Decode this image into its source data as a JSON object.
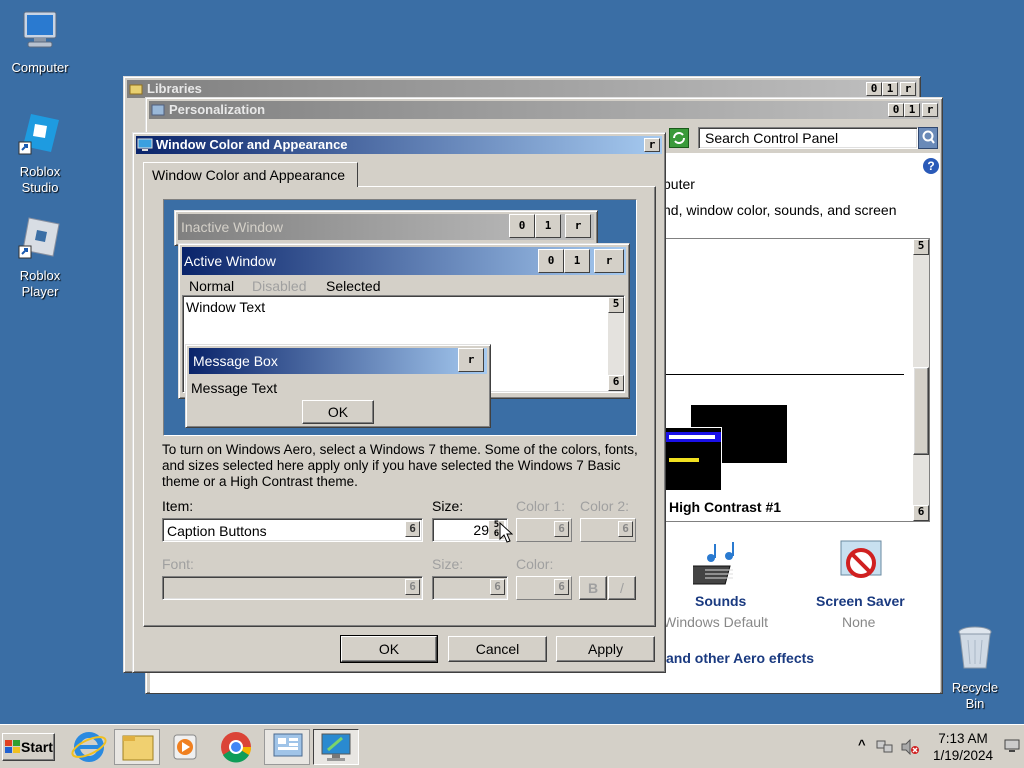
{
  "desktop": {
    "icons": [
      {
        "label": "Computer",
        "icon": "computer-icon"
      },
      {
        "label": "Roblox Studio",
        "icon": "roblox-studio-icon"
      },
      {
        "label": "Roblox Player",
        "icon": "roblox-player-icon"
      },
      {
        "label": "Recycle Bin",
        "icon": "recycle-bin-icon"
      }
    ]
  },
  "libraries_window": {
    "title": "Libraries",
    "buttons": [
      "0",
      "1",
      "r"
    ]
  },
  "personalization_window": {
    "title": "Personalization",
    "buttons": [
      "0",
      "1",
      "r"
    ],
    "search_placeholder": "Search Control Panel",
    "partial_text_1": "puter",
    "partial_text_2": "nd, window color, sounds, and screen",
    "theme_label": "High Contrast #1",
    "sounds_label": "Sounds",
    "sounds_value": "Windows Default",
    "screensaver_label": "Screen Saver",
    "screensaver_value": "None",
    "aero_link": "and other Aero effects",
    "scroll_up": "5",
    "scroll_down": "6"
  },
  "dialog": {
    "title": "Window Color and Appearance",
    "close": "r",
    "tab": "Window Color and Appearance",
    "preview": {
      "inactive_title": "Inactive Window",
      "active_title": "Active Window",
      "caption_buttons": [
        "0",
        "1",
        "r"
      ],
      "menu": {
        "normal": "Normal",
        "disabled": "Disabled",
        "selected": "Selected"
      },
      "window_text": "Window Text",
      "scroll_up": "5",
      "scroll_down": "6",
      "msgbox_title": "Message Box",
      "msgbox_close": "r",
      "msgbox_text": "Message Text",
      "msgbox_ok": "OK"
    },
    "description": "To turn on Windows Aero, select a Windows 7 theme.  Some of the colors, fonts, and sizes selected here apply only if you have selected the Windows 7 Basic theme or a High Contrast theme.",
    "item_label": "Item:",
    "item_value": "Caption Buttons",
    "size_label": "Size:",
    "size_value": "29",
    "color1_label": "Color 1:",
    "color2_label": "Color 2:",
    "font_label": "Font:",
    "font_size_label": "Size:",
    "font_color_label": "Color:",
    "bold_btn": "B",
    "italic_btn": "/",
    "dd_glyph": "6",
    "spin_up": "5",
    "spin_down": "6",
    "ok": "OK",
    "cancel": "Cancel",
    "apply": "Apply"
  },
  "taskbar": {
    "start": "Start",
    "time": "7:13 AM",
    "date": "1/19/2024",
    "tray_up": "^"
  }
}
